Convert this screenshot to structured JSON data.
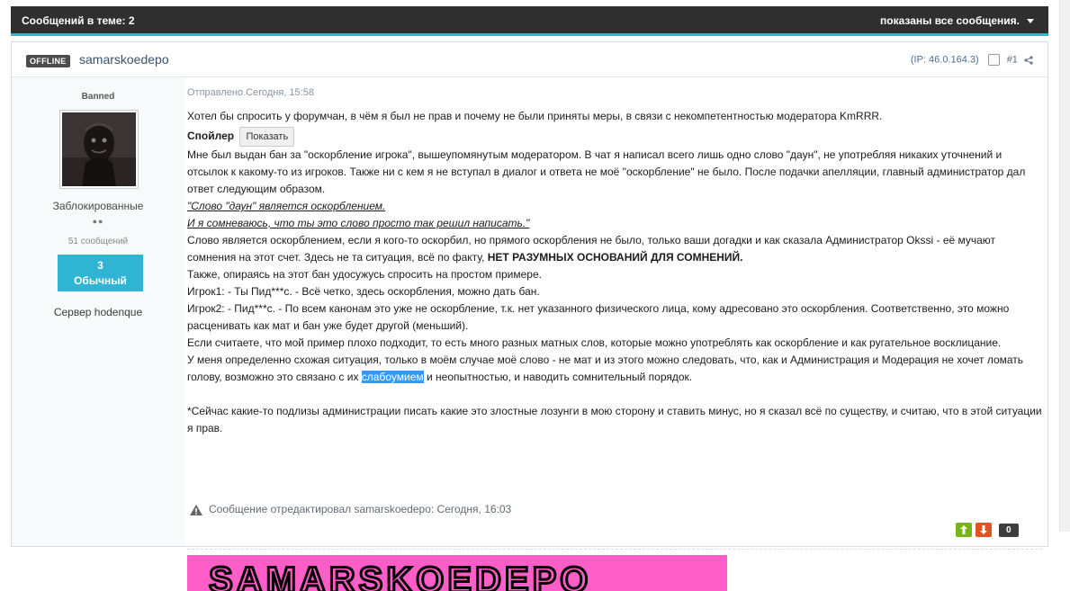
{
  "topbar": {
    "replies_label": "Сообщений в теме: 2",
    "filter_label": "показаны все сообщения."
  },
  "post": {
    "status_badge": "OFFLINE",
    "author": "samarskoedepo",
    "ip_text": "(IP: 46.0.164.3)",
    "post_number": "#1",
    "sent_label": "Отправлено Сегодня, 15:58",
    "edited_text": "Сообщение отредактировал samarskoedepo: Сегодня, 16:03",
    "vote_count": "0",
    "banner_text": "SAMARSKOEDEPO"
  },
  "author_panel": {
    "role": "Banned",
    "group": "Заблокированные",
    "pips": "●●",
    "post_count": "51 сообщений",
    "rep_number": "3",
    "rep_label": "Обычный",
    "server": "Сервер hodenque"
  },
  "body": {
    "intro": "Хотел бы спросить у форумчан, в чём я был не прав и почему не были приняты меры, в связи с некомпетентностью модератора KmRRR.",
    "spoiler_label": "Спойлер",
    "spoiler_button": "Показать",
    "p1": "Мне был выдан бан за \"оскорбление игрока\", вышеупомянутым модератором. В чат я написал всего лишь одно слово \"даун\", не употребляя никаких уточнений и отсылок к какому-то из игроков. Также ни с кем я не вступал в диалог и ответа не моё \"оскорбление\" не было. После подачки апелляции, главный администратор дал ответ следующим образом.",
    "quote1": "\"Слово \"даун\" является оскорблением.",
    "quote2": "И я сомневаюсь, что ты это слово просто так решил написать.\"",
    "p2_a": "Слово является оскорблением, если я кого-то оскорбил, но прямого оскорбления не было, только ваши догадки и как сказала Администратор Okssi - её мучают сомнения на этот счет. Здесь не та ситуация, всё по факту, ",
    "p2_bold": "НЕТ РАЗУМНЫХ ОСНОВАНИЙ ДЛЯ СОМНЕНИЙ.",
    "p3": "Также, опираясь на этот бан удосужусь спросить на простом примере.",
    "p4": "Игрок1: - Ты Пид***с.  - Всё четко, здесь оскорбления, можно дать бан.",
    "p5": "Игрок2: - Пид***с. - По всем канонам это уже не оскорбление, т.к. нет указанного физического лица, кому адресовано это оскорбления. Соответственно, это можно расценивать как мат и бан уже будет другой (меньший).",
    "p6": "Если считаете, что мой пример плохо подходит, то есть много разных матных слов, которые  можно употреблять как оскорбление и как ругательное восклицание.",
    "p7_a": "У меня определенно схожая ситуация, только в моём случае моё слово - не мат и из этого можно следовать, что, как и Администрация и Модерация не хочет ломать голову, возможно это связано с их ",
    "p7_hl": "слабоумием",
    "p7_b": " и неопытностью, и наводить сомнительный порядок.",
    "p8": "*Сейчас какие-то подлизы администрации писать какие это злостные лозунги в мою сторону и ставить минус, но я сказал всё по существу, и считаю, что в этой ситуации я прав."
  }
}
